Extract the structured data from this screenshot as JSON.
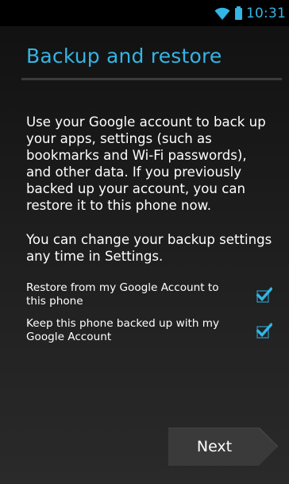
{
  "status_bar": {
    "time": "10:31",
    "icons": [
      "wifi-icon",
      "battery-icon"
    ]
  },
  "page": {
    "title": "Backup and restore",
    "description": "Use your Google account to back up your apps, settings (such as bookmarks and Wi-Fi passwords), and other data. If you previously backed up your account, you can restore it to this phone now.",
    "note": "You can change your backup settings any time in Settings."
  },
  "options": [
    {
      "label": "Restore from my Google Account to this phone",
      "checked": true
    },
    {
      "label": "Keep this phone backed up with my Google Account",
      "checked": true
    }
  ],
  "footer": {
    "next_label": "Next"
  },
  "colors": {
    "accent": "#33b5e5",
    "text": "#ffffff",
    "button": "#3a3a3a"
  }
}
